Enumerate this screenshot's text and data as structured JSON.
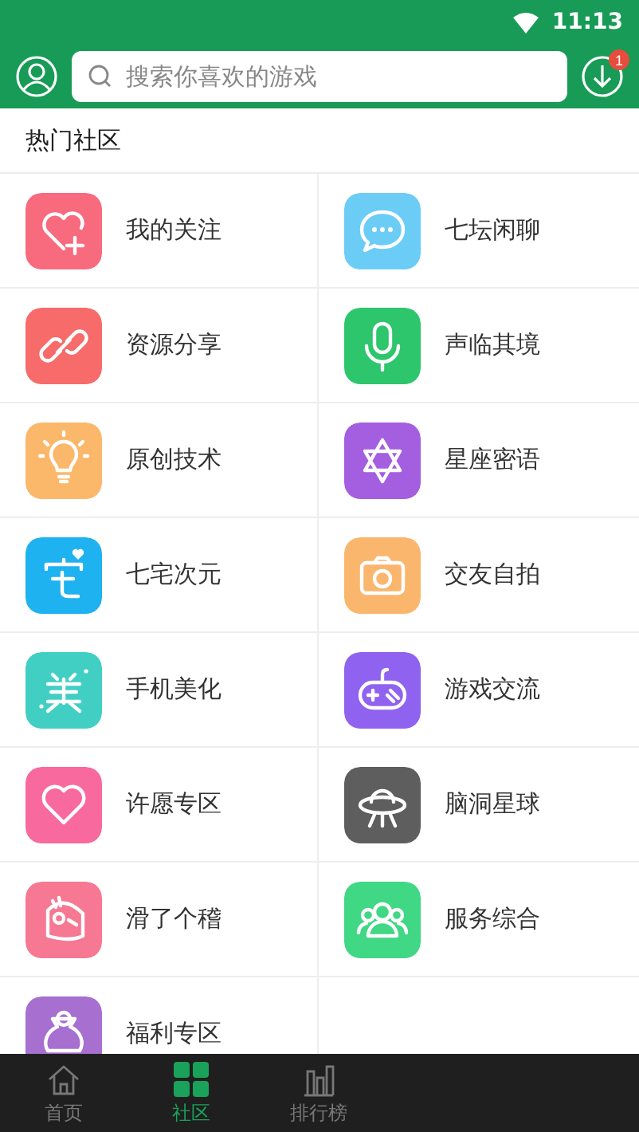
{
  "status_bar": {
    "time": "11:13"
  },
  "header": {
    "search": {
      "placeholder": "搜索你喜欢的游戏"
    },
    "download_badge": "1"
  },
  "section": {
    "title": "热门社区"
  },
  "items": [
    {
      "label": "我的关注",
      "color": "#f86a7e"
    },
    {
      "label": "七坛闲聊",
      "color": "#6bcdf6"
    },
    {
      "label": "资源分享",
      "color": "#f76b6b"
    },
    {
      "label": "声临其境",
      "color": "#2dc66c"
    },
    {
      "label": "原创技术",
      "color": "#fbb86a"
    },
    {
      "label": "星座密语",
      "color": "#a45ee0"
    },
    {
      "label": "七宅次元",
      "color": "#1eb2f0"
    },
    {
      "label": "交友自拍",
      "color": "#fbb66e"
    },
    {
      "label": "手机美化",
      "color": "#41cfc4"
    },
    {
      "label": "游戏交流",
      "color": "#9062f0"
    },
    {
      "label": "许愿专区",
      "color": "#f8699e"
    },
    {
      "label": "脑洞星球",
      "color": "#5e5e5e"
    },
    {
      "label": "滑了个稽",
      "color": "#f67893"
    },
    {
      "label": "服务综合",
      "color": "#40d785"
    },
    {
      "label": "福利专区",
      "color": "#a66fd0"
    }
  ],
  "bottom_nav": [
    {
      "label": "首页",
      "selected": false
    },
    {
      "label": "社区",
      "selected": true
    },
    {
      "label": "排行榜",
      "selected": false
    }
  ]
}
